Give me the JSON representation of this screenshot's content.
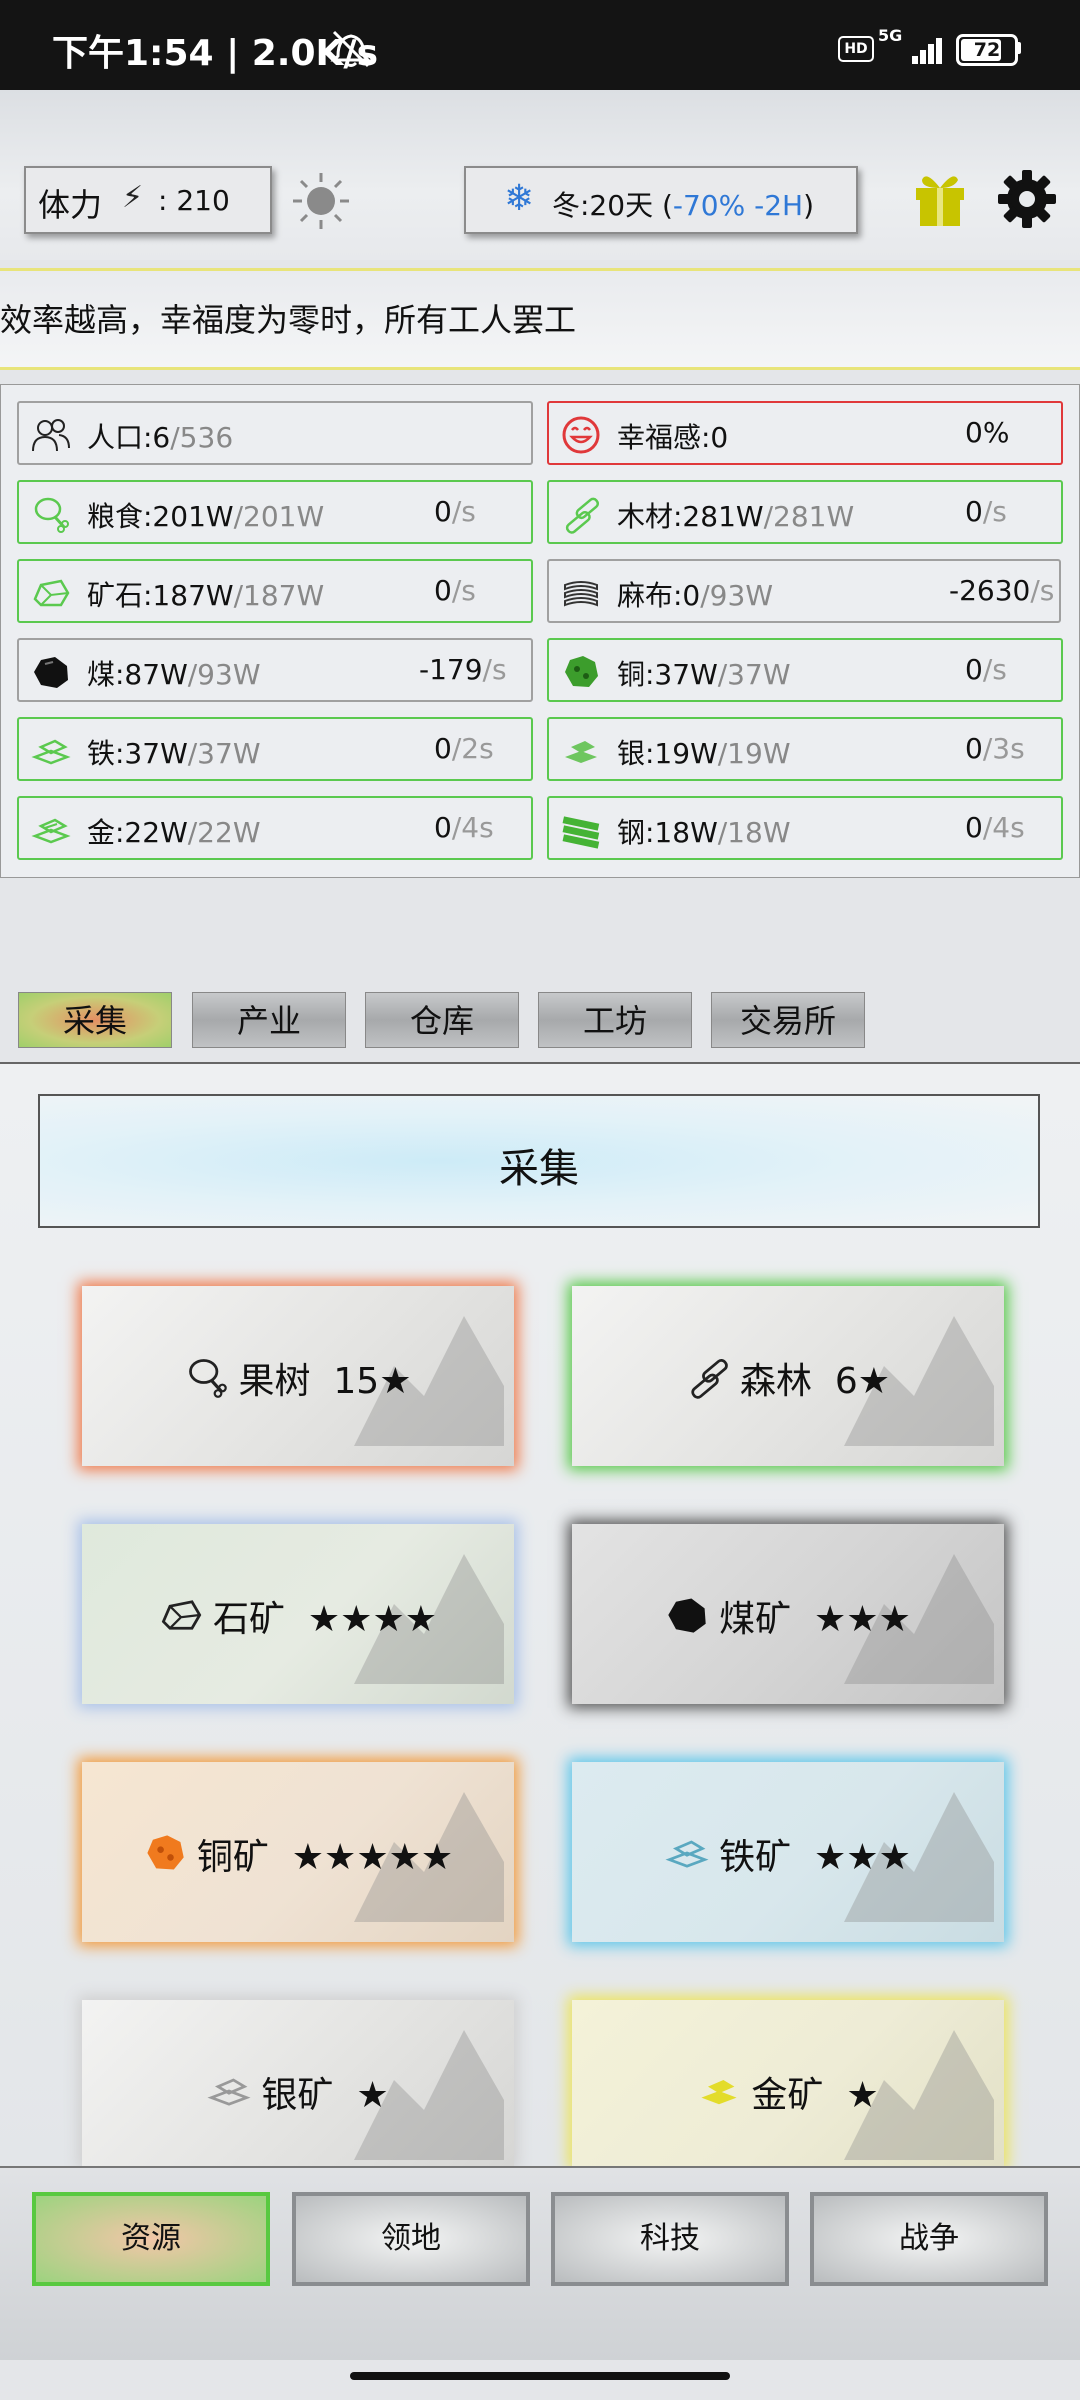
{
  "status_bar": {
    "time": "下午1:54 | 2.0K/s",
    "network": "5G",
    "hd": "HD",
    "battery": "72",
    "battery_level": 0.72,
    "icons": [
      "mute-icon",
      "signal-icon",
      "battery-icon"
    ]
  },
  "header": {
    "stamina_label": "体力",
    "stamina_value": ": 210",
    "season_prefix": "冬:20天 (",
    "season_effect": "-70% -2H",
    "season_suffix": ")",
    "icons": [
      "bolt-icon",
      "sun-icon",
      "snowflake-icon",
      "gift-icon",
      "gear-icon"
    ]
  },
  "marquee": {
    "text": "效率越高，幸福度为零时，所有工人罢工"
  },
  "resources": [
    {
      "name": "人口:6",
      "max": "/536",
      "rate": "",
      "unit": "",
      "icon": "population-icon"
    },
    {
      "name": "幸福感:0",
      "max": "",
      "rate": "0%",
      "unit": "",
      "icon": "smiley-icon"
    },
    {
      "name": "粮食:201W",
      "max": "/201W",
      "rate": "0",
      "unit": "/s",
      "icon": "food-icon"
    },
    {
      "name": "木材:281W",
      "max": "/281W",
      "rate": "0",
      "unit": "/s",
      "icon": "wood-icon"
    },
    {
      "name": "矿石:187W",
      "max": "/187W",
      "rate": "0",
      "unit": "/s",
      "icon": "ore-icon"
    },
    {
      "name": "麻布:0",
      "max": "/93W",
      "rate": "-2630",
      "unit": "/s",
      "icon": "linen-icon"
    },
    {
      "name": "煤:87W",
      "max": "/93W",
      "rate": "-179",
      "unit": "/s",
      "icon": "coal-icon"
    },
    {
      "name": "铜:37W",
      "max": "/37W",
      "rate": "0",
      "unit": "/s",
      "icon": "copper-icon"
    },
    {
      "name": "铁:37W",
      "max": "/37W",
      "rate": "0",
      "unit": "/2s",
      "icon": "iron-icon"
    },
    {
      "name": "银:19W",
      "max": "/19W",
      "rate": "0",
      "unit": "/3s",
      "icon": "silver-icon"
    },
    {
      "name": "金:22W",
      "max": "/22W",
      "rate": "0",
      "unit": "/4s",
      "icon": "gold-icon"
    },
    {
      "name": "钢:18W",
      "max": "/18W",
      "rate": "0",
      "unit": "/4s",
      "icon": "steel-icon"
    }
  ],
  "tabs": [
    "采集",
    "产业",
    "仓库",
    "工坊",
    "交易所"
  ],
  "banner_title": "采集",
  "cards": [
    {
      "label": "果树",
      "stars": "15★",
      "icon": "fruit-tree-icon",
      "glow": "#f07a4a"
    },
    {
      "label": "森林",
      "stars": "6★",
      "icon": "forest-icon",
      "glow": "#58c94a"
    },
    {
      "label": "石矿",
      "stars": "★★★★",
      "icon": "stone-icon",
      "glow": "#a9c1e8"
    },
    {
      "label": "煤矿",
      "stars": "★★★",
      "icon": "coal-icon",
      "glow": "#333333"
    },
    {
      "label": "铜矿",
      "stars": "★★★★★",
      "icon": "copper-icon",
      "glow": "#f39a3a"
    },
    {
      "label": "铁矿",
      "stars": "★★★",
      "icon": "iron-icon",
      "glow": "#5cc6ea"
    },
    {
      "label": "银矿",
      "stars": "★",
      "icon": "silver-icon",
      "glow": "#cfcfcf"
    },
    {
      "label": "金矿",
      "stars": "★",
      "icon": "gold-icon",
      "glow": "#ece45a"
    }
  ],
  "bottom_nav": [
    "资源",
    "领地",
    "科技",
    "战争"
  ],
  "colors": {
    "accent_blue": "#2f78d6",
    "green_border": "#5bc94f",
    "red_border": "#e0383a",
    "gift_yellow": "#c8c400"
  }
}
